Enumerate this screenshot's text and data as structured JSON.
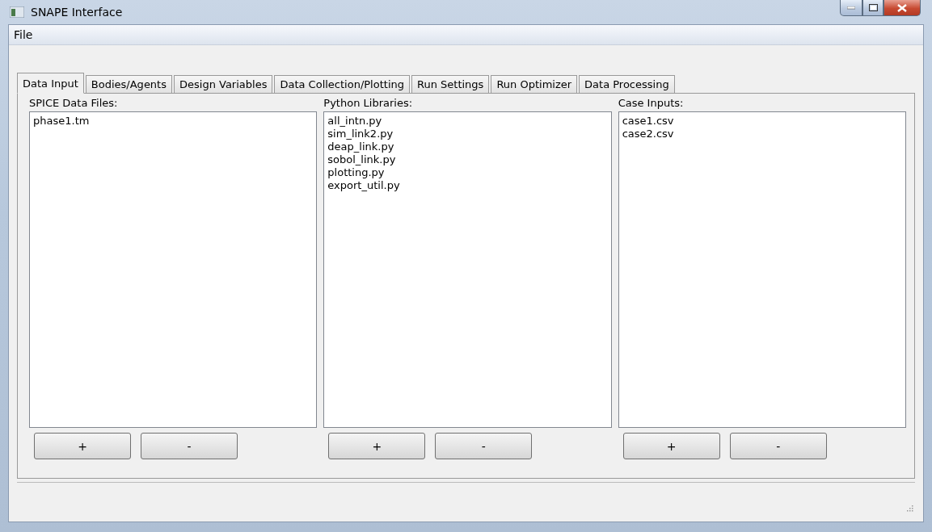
{
  "window": {
    "title": "SNAPE Interface"
  },
  "menu": [
    "File"
  ],
  "tabs": [
    {
      "label": "Data Input",
      "selected": true
    },
    {
      "label": "Bodies/Agents",
      "selected": false
    },
    {
      "label": "Design Variables",
      "selected": false
    },
    {
      "label": "Data Collection/Plotting",
      "selected": false
    },
    {
      "label": "Run Settings",
      "selected": false
    },
    {
      "label": "Run Optimizer",
      "selected": false
    },
    {
      "label": "Data Processing",
      "selected": false
    }
  ],
  "panels": [
    {
      "label": "SPICE Data Files:",
      "items": [
        "phase1.tm"
      ],
      "buttons": [
        "+",
        "-"
      ]
    },
    {
      "label": "Python Libraries:",
      "items": [
        "all_intn.py",
        "sim_link2.py",
        "deap_link.py",
        "sobol_link.py",
        "plotting.py",
        "export_util.py"
      ],
      "buttons": [
        "+",
        "-"
      ]
    },
    {
      "label": "Case Inputs:",
      "items": [
        "case1.csv",
        "case2.csv"
      ],
      "buttons": [
        "+",
        "-"
      ]
    }
  ]
}
